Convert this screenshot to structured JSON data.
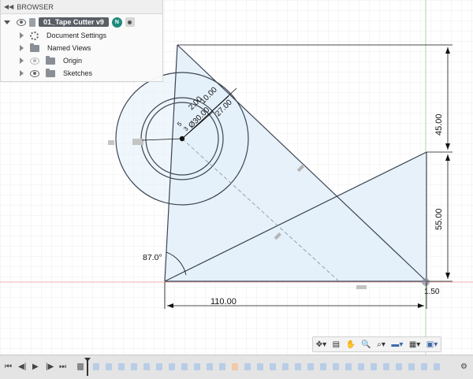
{
  "browser": {
    "title": "BROWSER",
    "document": "01_Tape Cutter v9",
    "badge": "N",
    "items": [
      {
        "label": "Document Settings",
        "icon": "gear-icon"
      },
      {
        "label": "Named Views",
        "icon": "folder-icon"
      },
      {
        "label": "Origin",
        "icon": "folder-icon",
        "visible": false
      },
      {
        "label": "Sketches",
        "icon": "folder-icon",
        "visible": true
      }
    ]
  },
  "sketch": {
    "dimensions": {
      "width": "110.00",
      "upper_height": "45.00",
      "lower_height": "55.00",
      "offset": "1.50",
      "angle": "87.0°",
      "inner_diameter": "Ø30.00",
      "radial_2": "2.00",
      "radial_10": "10.00",
      "radial_27": "27.00",
      "small_5": "5",
      "small_3": "3"
    },
    "colors": {
      "profile_fill": "#e3f0fa",
      "line": "#3d4454",
      "dimension": "#111111",
      "grid": "#eeeeee",
      "axis_red": "#e8b0b0",
      "axis_green": "#a6d9a6"
    }
  },
  "navbar": {
    "icons": [
      "orbit-icon",
      "look-at-icon",
      "pan-icon",
      "zoom-icon",
      "zoom-window-icon",
      "display-icon",
      "grid-icon",
      "viewports-icon"
    ]
  },
  "timeline": {
    "controls": [
      "first-icon",
      "previous-icon",
      "play-icon",
      "next-icon",
      "last-icon"
    ]
  }
}
